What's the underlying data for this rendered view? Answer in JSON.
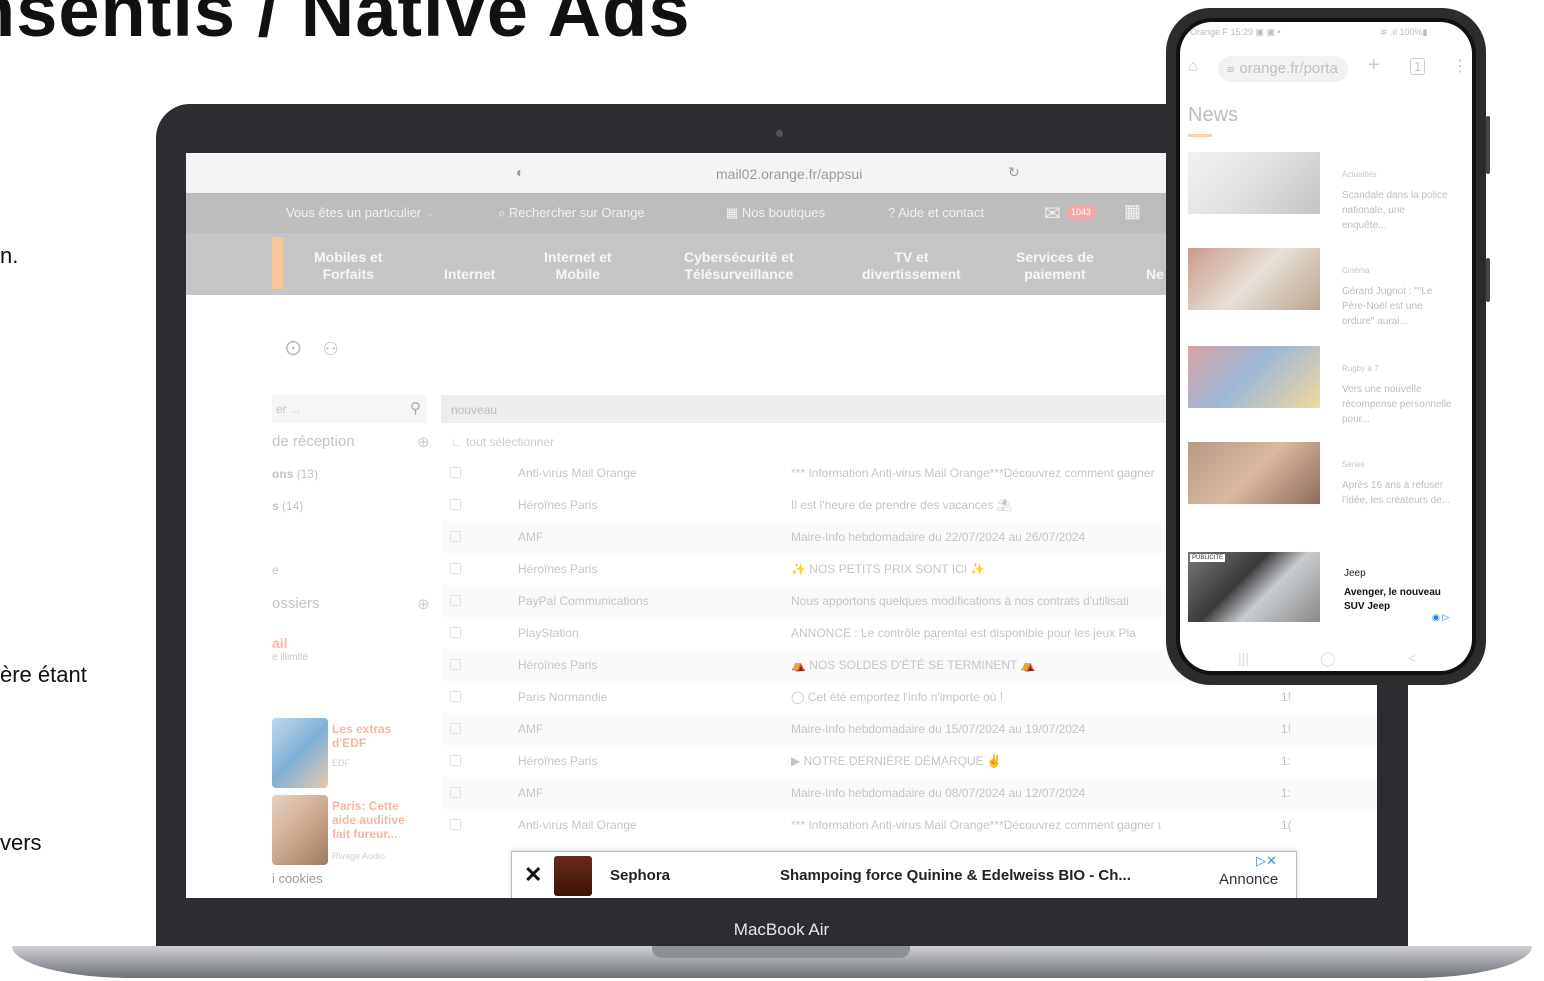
{
  "slide": {
    "title": "nsentis / Native Ads",
    "side_texts": [
      "n.",
      "ère étant",
      "vers"
    ]
  },
  "laptop": {
    "label": "MacBook Air",
    "url": "mail02.orange.fr/appsui",
    "topnav": {
      "particulier": "Vous êtes un particulier",
      "search": "Rechercher sur Orange",
      "boutiques": "Nos boutiques",
      "aide": "Aide et contact",
      "mail_count": "1043"
    },
    "categories": [
      {
        "l1": "Mobiles et",
        "l2": "Forfaits"
      },
      {
        "l1": "",
        "l2": "Internet"
      },
      {
        "l1": "Internet et",
        "l2": "Mobile"
      },
      {
        "l1": "Cybersécurité et",
        "l2": "Télésurveillance"
      },
      {
        "l1": "TV et",
        "l2": "divertissement"
      },
      {
        "l1": "Services de",
        "l2": "paiement"
      },
      {
        "l1": "",
        "l2": "Ne"
      }
    ],
    "sidebar": {
      "search_placeholder": "er ...",
      "inbox": "de réception",
      "f1": "ons",
      "f1_count": "(13)",
      "f2": "s",
      "f2_count": "(14)",
      "f3": "e",
      "folders": "ossiers",
      "mail_title": "ail",
      "mail_sub": "e illimité",
      "ad1_title": "Les extras d'EDF",
      "ad1_source": "EDF",
      "ad2_title": "Paris: Cette aide auditive fait fureur...",
      "ad2_source": "Rivage Audio",
      "cookies": "i cookies"
    },
    "mail": {
      "header": "nouveau",
      "select_all": "tout sélectionner",
      "rows": [
        {
          "from": "Anti-virus Mail Orange",
          "subject": "*** Information Anti-virus Mail Orange***Découvrez comment gagner",
          "date": ""
        },
        {
          "from": "Héroïnes Paris",
          "subject": "Il est l'heure de prendre des vacances ⛱",
          "date": ""
        },
        {
          "from": "AMF",
          "subject": "Maire-Info hebdomadaire du 22/07/2024 au 26/07/2024",
          "date": ""
        },
        {
          "from": "Héroïnes Paris",
          "subject": "✨ NOS PETITS PRIX SONT ICI ✨",
          "date": ""
        },
        {
          "from": "PayPal Communications",
          "subject": "Nous apportons quelques modifications à nos contrats d'utilisati",
          "date": ""
        },
        {
          "from": "PlayStation",
          "subject": "ANNONCE : Le contrôle parental est disponible pour les jeux Pla",
          "date": ""
        },
        {
          "from": "Héroïnes Paris",
          "subject": "⛺ NOS SOLDES D'ÉTÉ SE TERMINENT ⛺",
          "date": ""
        },
        {
          "from": "Paris Normandie",
          "subject": "◯ Cet été emportez l'info n'importe où !",
          "date": "1!"
        },
        {
          "from": "AMF",
          "subject": "Maire-Info hebdomadaire du 15/07/2024 au 19/07/2024",
          "date": "1!"
        },
        {
          "from": "Héroïnes Paris",
          "subject": "▶ NOTRE DERNIÈRE DÉMARQUE ✌",
          "date": "1:"
        },
        {
          "from": "AMF",
          "subject": "Maire-Info hebdomadaire du 08/07/2024 au 12/07/2024",
          "date": "1:"
        },
        {
          "from": "Anti-virus Mail Orange",
          "subject": "*** Information Anti-virus Mail Orange***Découvrez comment gagner u...",
          "date": "1("
        }
      ]
    },
    "ad_banner": {
      "close": "✕",
      "brand": "Sephora",
      "headline": "Shampoing force Quinine & Edelweiss BIO - Ch...",
      "annonce": "Annonce",
      "adchoice": "▷✕"
    }
  },
  "phone": {
    "status_left": "Orange F  15:29  ▣ ▣  •",
    "status_right": "≋ .ıl 100%▮",
    "url": "orange.fr/porta",
    "news_heading": "News",
    "articles": [
      {
        "cat": "Actualités",
        "title": "Scandale dans la police nationale, une enquête..."
      },
      {
        "cat": "Cinéma",
        "title": "Gérard Jugnot : \"\"Le Père-Noël est une ordure\" aurai..."
      },
      {
        "cat": "Rugby à 7",
        "title": "Vers une nouvelle récompense personnelle pour..."
      },
      {
        "cat": "Séries",
        "title": "Après 16 ans à refuser l'idée, les créateurs de..."
      }
    ],
    "ad": {
      "label": "PUBLICITÉ",
      "brand": "Jeep",
      "title": "Avenger, le nouveau SUV Jeep",
      "icons": "◉ ▷"
    },
    "nav": {
      "recent": "|||",
      "home": "◯",
      "back": "<"
    }
  }
}
